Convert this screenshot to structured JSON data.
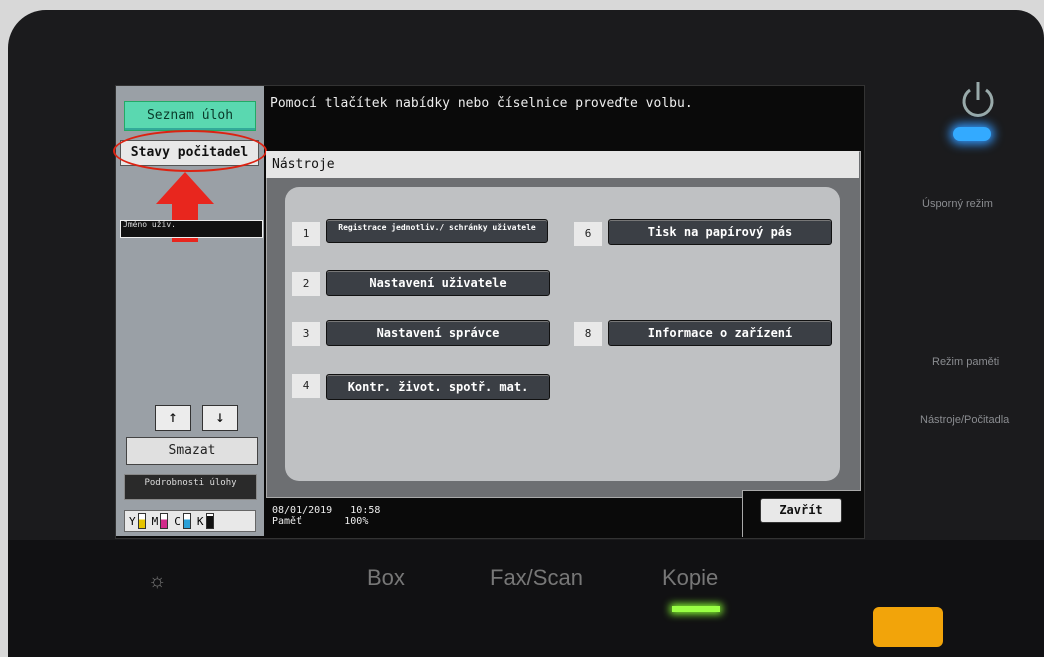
{
  "left_panel": {
    "job_list": "Seznam úloh",
    "counter_status": "Stavy počitadel",
    "user_name_label": "Jméno uživ.",
    "up": "↑",
    "down": "↓",
    "clear": "Smazat",
    "job_details": "Podrobnosti úlohy",
    "toner": [
      "Y",
      "M",
      "C",
      "K"
    ]
  },
  "message": "Pomocí tlačítek nabídky nebo číselnice proveďte volbu.",
  "window": {
    "title": "Nástroje",
    "options": [
      {
        "num": "1",
        "label": "Registrace jednotliv./ schránky uživatele"
      },
      {
        "num": "2",
        "label": "Nastavení uživatele"
      },
      {
        "num": "3",
        "label": "Nastavení správce"
      },
      {
        "num": "4",
        "label": "Kontr. život. spotř. mat."
      },
      {
        "num": "6",
        "label": "Tisk na papírový pás"
      },
      {
        "num": "8",
        "label": "Informace o zařízení"
      }
    ],
    "close": "Zavřít"
  },
  "status": {
    "date": "08/01/2019",
    "time": "10:58",
    "memory_label": "Paměť",
    "memory_value": "100%"
  },
  "side_labels": {
    "eco": "Úsporný režim",
    "memory_mode": "Režim paměti",
    "tools_counter": "Nástroje/Počitadla"
  },
  "bottom_buttons": {
    "box": "Box",
    "fax_scan": "Fax/Scan",
    "copy": "Kopie"
  },
  "colors": {
    "highlight": "#d21f1f",
    "job_list_button": "#5ad8b0",
    "power_led": "#33aaff",
    "copy_led": "#99ff44",
    "start_button": "#f2a40a"
  }
}
